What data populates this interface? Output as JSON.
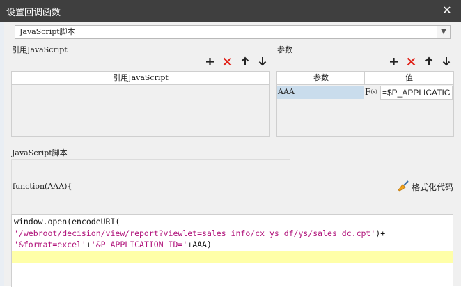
{
  "window": {
    "title": "设置回调函数"
  },
  "script_type": {
    "selected": "JavaScript脚本"
  },
  "ref_js": {
    "label": "引用JavaScript",
    "column_header": "引用JavaScript"
  },
  "params": {
    "label": "参数",
    "col_param": "参数",
    "col_value": "值",
    "rows": [
      {
        "name": "AAA",
        "value": "=$P_APPLICATIC"
      }
    ]
  },
  "js_section": {
    "label": "JavaScript脚本",
    "function_signature": "function(AAA){",
    "format_label": "格式化代码"
  },
  "code": {
    "line1_fn": "window.open(encodeURI(",
    "line2_str": "'/webroot/decision/view/report?viewlet=sales_info/cx_ys_df/ys/sales_dc.cpt'",
    "line2_tail": ")+",
    "line3_str1": "'&format=excel'",
    "line3_plus": "+",
    "line3_str2": "'&P_APPLICATION_ID='",
    "line3_tail": "+AAA)"
  },
  "colors": {
    "title_bar": "#3f3f3f",
    "add": "#222222",
    "delete": "#e0231a",
    "string": "#b0127a",
    "current_line": "#ffffa8",
    "selected_cell": "#c9dcec"
  }
}
